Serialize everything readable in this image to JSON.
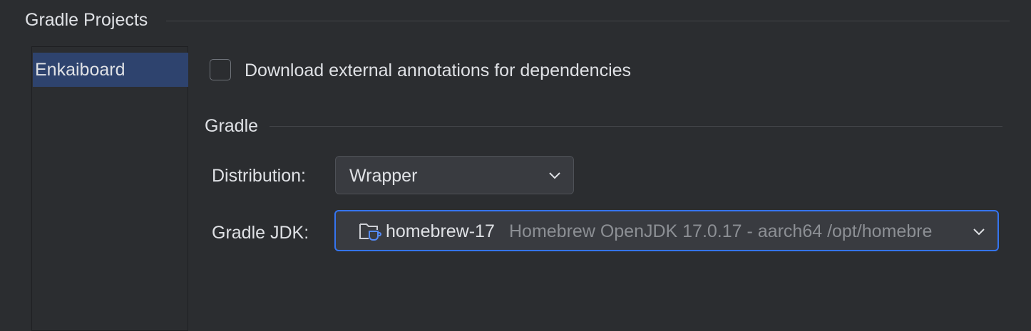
{
  "section": {
    "title": "Gradle Projects"
  },
  "projects": [
    "Enkaiboard"
  ],
  "options": {
    "download_annotations_label": "Download external annotations for dependencies",
    "download_annotations_checked": false
  },
  "gradle": {
    "title": "Gradle",
    "distribution_label": "Distribution:",
    "distribution_value": "Wrapper",
    "jdk_label": "Gradle JDK:",
    "jdk_name": "homebrew-17",
    "jdk_detail": "Homebrew OpenJDK 17.0.17 - aarch64 /opt/homebre"
  },
  "icons": {
    "jdk": "folder-java-icon",
    "dropdown": "chevron-down-icon"
  },
  "colors": {
    "background": "#2b2d30",
    "selection": "#2e436e",
    "focus_border": "#3574f0"
  }
}
